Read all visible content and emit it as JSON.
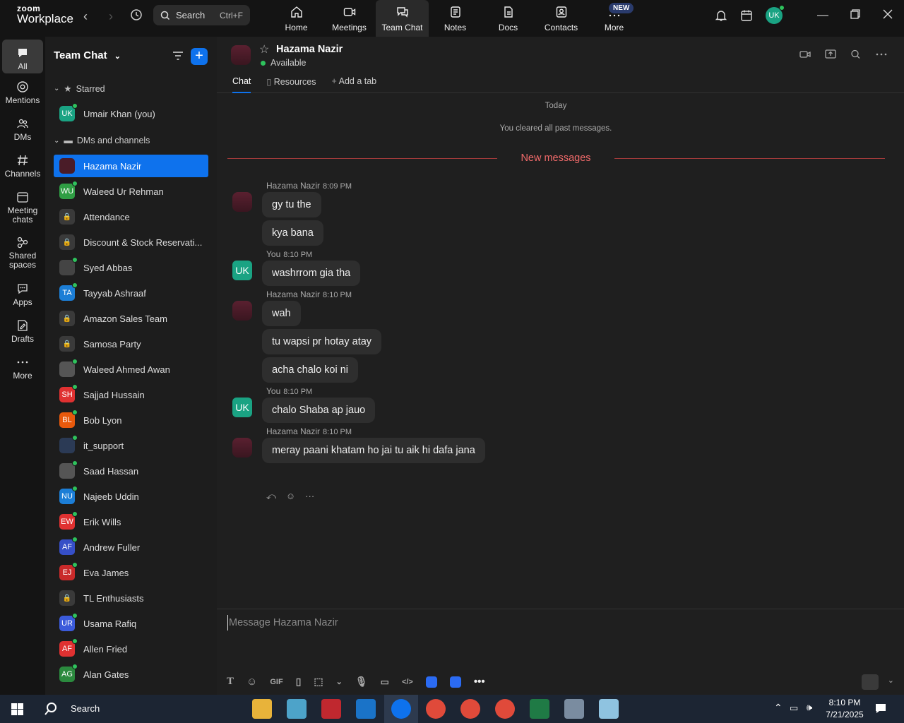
{
  "app": {
    "brand_small": "zoom",
    "brand_large": "Workplace"
  },
  "search": {
    "label": "Search",
    "shortcut": "Ctrl+F"
  },
  "topnav": [
    {
      "label": "Home",
      "icon": "home-icon"
    },
    {
      "label": "Meetings",
      "icon": "video-icon"
    },
    {
      "label": "Team Chat",
      "icon": "chat-icon"
    },
    {
      "label": "Notes",
      "icon": "notes-icon"
    },
    {
      "label": "Docs",
      "icon": "docs-icon"
    },
    {
      "label": "Contacts",
      "icon": "contacts-icon"
    },
    {
      "label": "More",
      "icon": "more-icon"
    }
  ],
  "new_badge": "NEW",
  "user_initials": "UK",
  "rail": [
    {
      "label": "All"
    },
    {
      "label": "Mentions"
    },
    {
      "label": "DMs"
    },
    {
      "label": "Channels"
    },
    {
      "label": "Meeting chats"
    },
    {
      "label": "Shared spaces"
    },
    {
      "label": "Apps"
    },
    {
      "label": "Drafts"
    },
    {
      "label": "More"
    }
  ],
  "panel": {
    "title": "Team Chat",
    "starred_label": "Starred",
    "dms_label": "DMs and channels",
    "starred": [
      {
        "name": "Umair Khan (you)",
        "initials": "UK",
        "color": "#1aa383"
      }
    ],
    "items": [
      {
        "name": "Hazama Nazir",
        "initials": "",
        "color": "#4a1c28"
      },
      {
        "name": "Waleed Ur Rehman",
        "initials": "WU",
        "color": "#2f9e44"
      },
      {
        "name": "Attendance",
        "initials": "",
        "color": "#3a3a3a"
      },
      {
        "name": "Discount & Stock Reservati...",
        "initials": "",
        "color": "#3a3a3a"
      },
      {
        "name": "Syed Abbas",
        "initials": "",
        "color": "#444"
      },
      {
        "name": "Tayyab Ashraaf",
        "initials": "TA",
        "color": "#1c7ed6"
      },
      {
        "name": "Amazon Sales Team",
        "initials": "",
        "color": "#3a3a3a"
      },
      {
        "name": "Samosa Party",
        "initials": "",
        "color": "#3a3a3a"
      },
      {
        "name": "Waleed Ahmed Awan",
        "initials": "",
        "color": "#555"
      },
      {
        "name": "Sajjad Hussain",
        "initials": "SH",
        "color": "#e03131"
      },
      {
        "name": "Bob Lyon",
        "initials": "BL",
        "color": "#e8590c"
      },
      {
        "name": "it_support",
        "initials": "",
        "color": "#2b3a55"
      },
      {
        "name": "Saad Hassan",
        "initials": "",
        "color": "#555"
      },
      {
        "name": "Najeeb Uddin",
        "initials": "NU",
        "color": "#1c7ed6"
      },
      {
        "name": "Erik Wills",
        "initials": "EW",
        "color": "#e03131"
      },
      {
        "name": "Andrew Fuller",
        "initials": "AF",
        "color": "#364fc7"
      },
      {
        "name": "Eva James",
        "initials": "EJ",
        "color": "#c92a2a"
      },
      {
        "name": "TL Enthusiasts",
        "initials": "",
        "color": "#3a3a3a"
      },
      {
        "name": "Usama Rafiq",
        "initials": "UR",
        "color": "#3b5bdb"
      },
      {
        "name": "Allen Fried",
        "initials": "AF",
        "color": "#e03131"
      },
      {
        "name": "Alan Gates",
        "initials": "AG",
        "color": "#2b8a3e"
      }
    ]
  },
  "chat": {
    "contact_name": "Hazama Nazir",
    "status": "Available",
    "tabs": [
      "Chat",
      "Resources",
      "Add a tab"
    ],
    "date_label": "Today",
    "cleared_note": "You cleared all past messages.",
    "new_messages_label": "New messages",
    "groups": [
      {
        "sender": "Hazama Nazir",
        "time": "8:09 PM",
        "messages": [
          "gy tu the",
          "kya bana"
        ]
      },
      {
        "sender": "You",
        "time": "8:10 PM",
        "messages": [
          "washrrom gia tha"
        ]
      },
      {
        "sender": "Hazama Nazir",
        "time": "8:10 PM",
        "messages": [
          "wah",
          "tu wapsi pr hotay atay",
          "acha chalo koi ni"
        ]
      },
      {
        "sender": "You",
        "time": "8:10 PM",
        "messages": [
          "chalo Shaba ap jauo"
        ]
      },
      {
        "sender": "Hazama Nazir",
        "time": "8:10 PM",
        "messages": [
          "meray paani khatam ho jai tu aik hi dafa jana"
        ]
      }
    ],
    "composer_placeholder": "Message Hazama Nazir",
    "gif_label": "GIF"
  },
  "taskbar": {
    "search_label": "Search",
    "time": "8:10 PM",
    "date": "7/21/2025"
  }
}
